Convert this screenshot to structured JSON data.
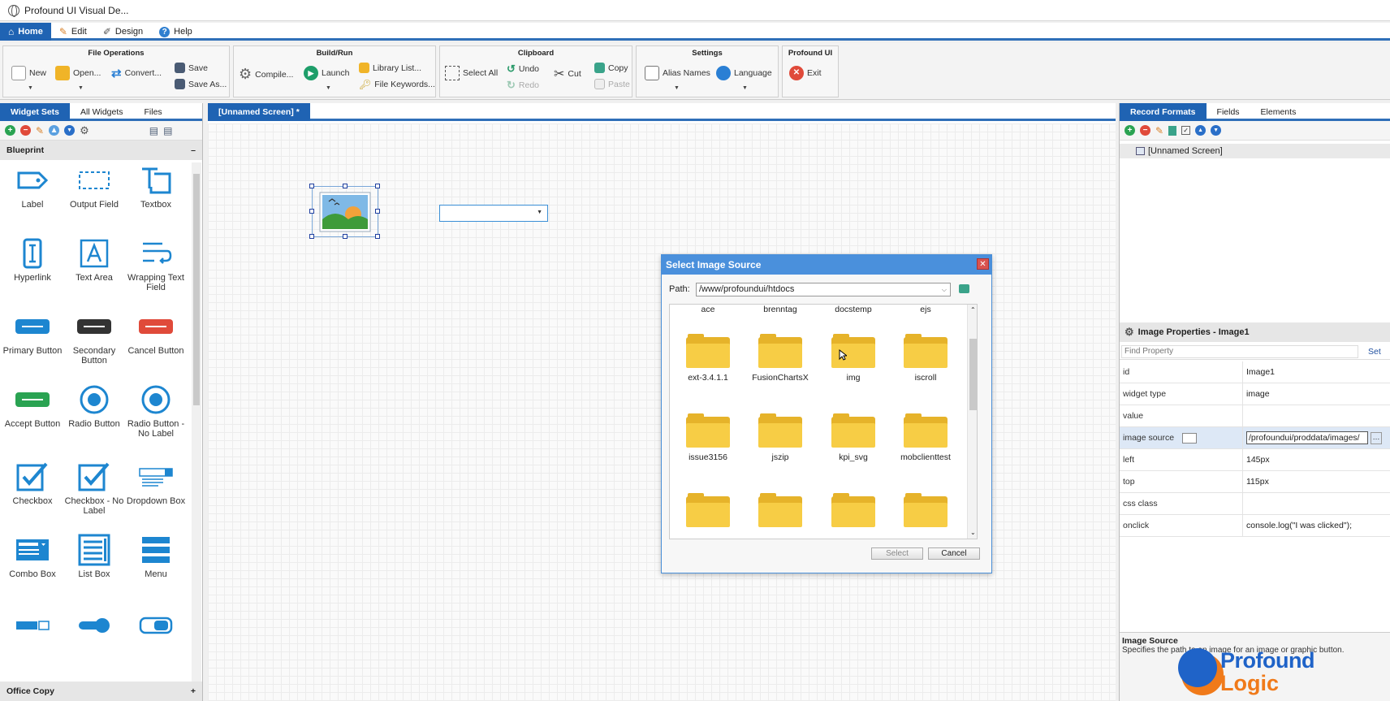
{
  "window": {
    "title": "Profound UI Visual De..."
  },
  "ribbon_tabs": [
    {
      "label": "Home",
      "icon": "home-icon"
    },
    {
      "label": "Edit",
      "icon": "pencil-icon"
    },
    {
      "label": "Design",
      "icon": "design-icon"
    },
    {
      "label": "Help",
      "icon": "help-icon"
    }
  ],
  "ribbon": {
    "file_operations": {
      "title": "File Operations",
      "new": "New",
      "open": "Open...",
      "convert": "Convert...",
      "save": "Save",
      "save_as": "Save As..."
    },
    "build_run": {
      "title": "Build/Run",
      "compile": "Compile...",
      "launch": "Launch",
      "library_list": "Library List...",
      "file_keywords": "File Keywords..."
    },
    "clipboard": {
      "title": "Clipboard",
      "select_all": "Select All",
      "undo": "Undo",
      "redo": "Redo",
      "cut": "Cut",
      "copy": "Copy",
      "paste": "Paste"
    },
    "settings": {
      "title": "Settings",
      "alias_names": "Alias Names",
      "language": "Language"
    },
    "profound_ui": {
      "title": "Profound UI",
      "exit": "Exit"
    }
  },
  "left_panel": {
    "tabs": [
      "Widget Sets",
      "All Widgets",
      "Files"
    ],
    "section": "Blueprint",
    "section_toggle": "–",
    "footer_section": "Office Copy",
    "footer_toggle": "+",
    "widgets": [
      {
        "label": "Label",
        "icon": "label-tag-icon"
      },
      {
        "label": "Output Field",
        "icon": "output-field-icon"
      },
      {
        "label": "Textbox",
        "icon": "textbox-icon"
      },
      {
        "label": "Hyperlink",
        "icon": "hyperlink-icon"
      },
      {
        "label": "Text Area",
        "icon": "text-area-icon"
      },
      {
        "label": "Wrapping Text Field",
        "icon": "wrapping-text-icon"
      },
      {
        "label": "Primary Button",
        "icon": "primary-button-icon"
      },
      {
        "label": "Secondary Button",
        "icon": "secondary-button-icon"
      },
      {
        "label": "Cancel Button",
        "icon": "cancel-button-icon"
      },
      {
        "label": "Accept Button",
        "icon": "accept-button-icon"
      },
      {
        "label": "Radio Button",
        "icon": "radio-button-icon"
      },
      {
        "label": "Radio Button - No Label",
        "icon": "radio-nolabel-icon"
      },
      {
        "label": "Checkbox",
        "icon": "checkbox-icon"
      },
      {
        "label": "Checkbox - No Label",
        "icon": "checkbox-nolabel-icon"
      },
      {
        "label": "Dropdown Box",
        "icon": "dropdown-box-icon"
      },
      {
        "label": "Combo Box",
        "icon": "combo-box-icon"
      },
      {
        "label": "List Box",
        "icon": "list-box-icon"
      },
      {
        "label": "Menu",
        "icon": "menu-icon"
      },
      {
        "label": "",
        "icon": "combo-partial-icon"
      },
      {
        "label": "",
        "icon": "toggle-on-icon"
      },
      {
        "label": "",
        "icon": "toggle-off-icon"
      }
    ]
  },
  "center": {
    "tab": "[Unnamed Screen] *"
  },
  "dialog": {
    "title": "Select Image Source",
    "path_label": "Path:",
    "path_value": "/www/profoundui/htdocs",
    "top_row": [
      "ace",
      "brenntag",
      "docstemp",
      "ejs"
    ],
    "folders": [
      "ext-3.4.1.1",
      "FusionChartsX",
      "img",
      "iscroll",
      "issue3156",
      "jszip",
      "kpi_svg",
      "mobclienttest",
      "",
      "",
      "",
      ""
    ],
    "select_label": "Select",
    "cancel_label": "Cancel"
  },
  "right_panel": {
    "tabs": [
      "Record Formats",
      "Fields",
      "Elements"
    ],
    "tree_item": "[Unnamed Screen]",
    "props_title": "Image Properties - Image1",
    "find_placeholder": "Find Property",
    "set_label": "Set",
    "properties": [
      {
        "key": "id",
        "value": "Image1"
      },
      {
        "key": "widget type",
        "value": "image"
      },
      {
        "key": "value",
        "value": ""
      },
      {
        "key": "image source",
        "value": "/profoundui/proddata/images/"
      },
      {
        "key": "left",
        "value": "145px"
      },
      {
        "key": "top",
        "value": "115px"
      },
      {
        "key": "css class",
        "value": ""
      },
      {
        "key": "onclick",
        "value": "console.log(\"I was clicked\");"
      }
    ],
    "help_title": "Image Source",
    "help_text": "Specifies the path to an image for an image or graphic button."
  },
  "watermark": {
    "line1": "Profound",
    "line2": "Logic"
  },
  "colors": {
    "accent": "#1f63b3",
    "dialog_title": "#4a90dc",
    "folder": "#f7cd45",
    "widget_blue": "#1d86d0"
  }
}
